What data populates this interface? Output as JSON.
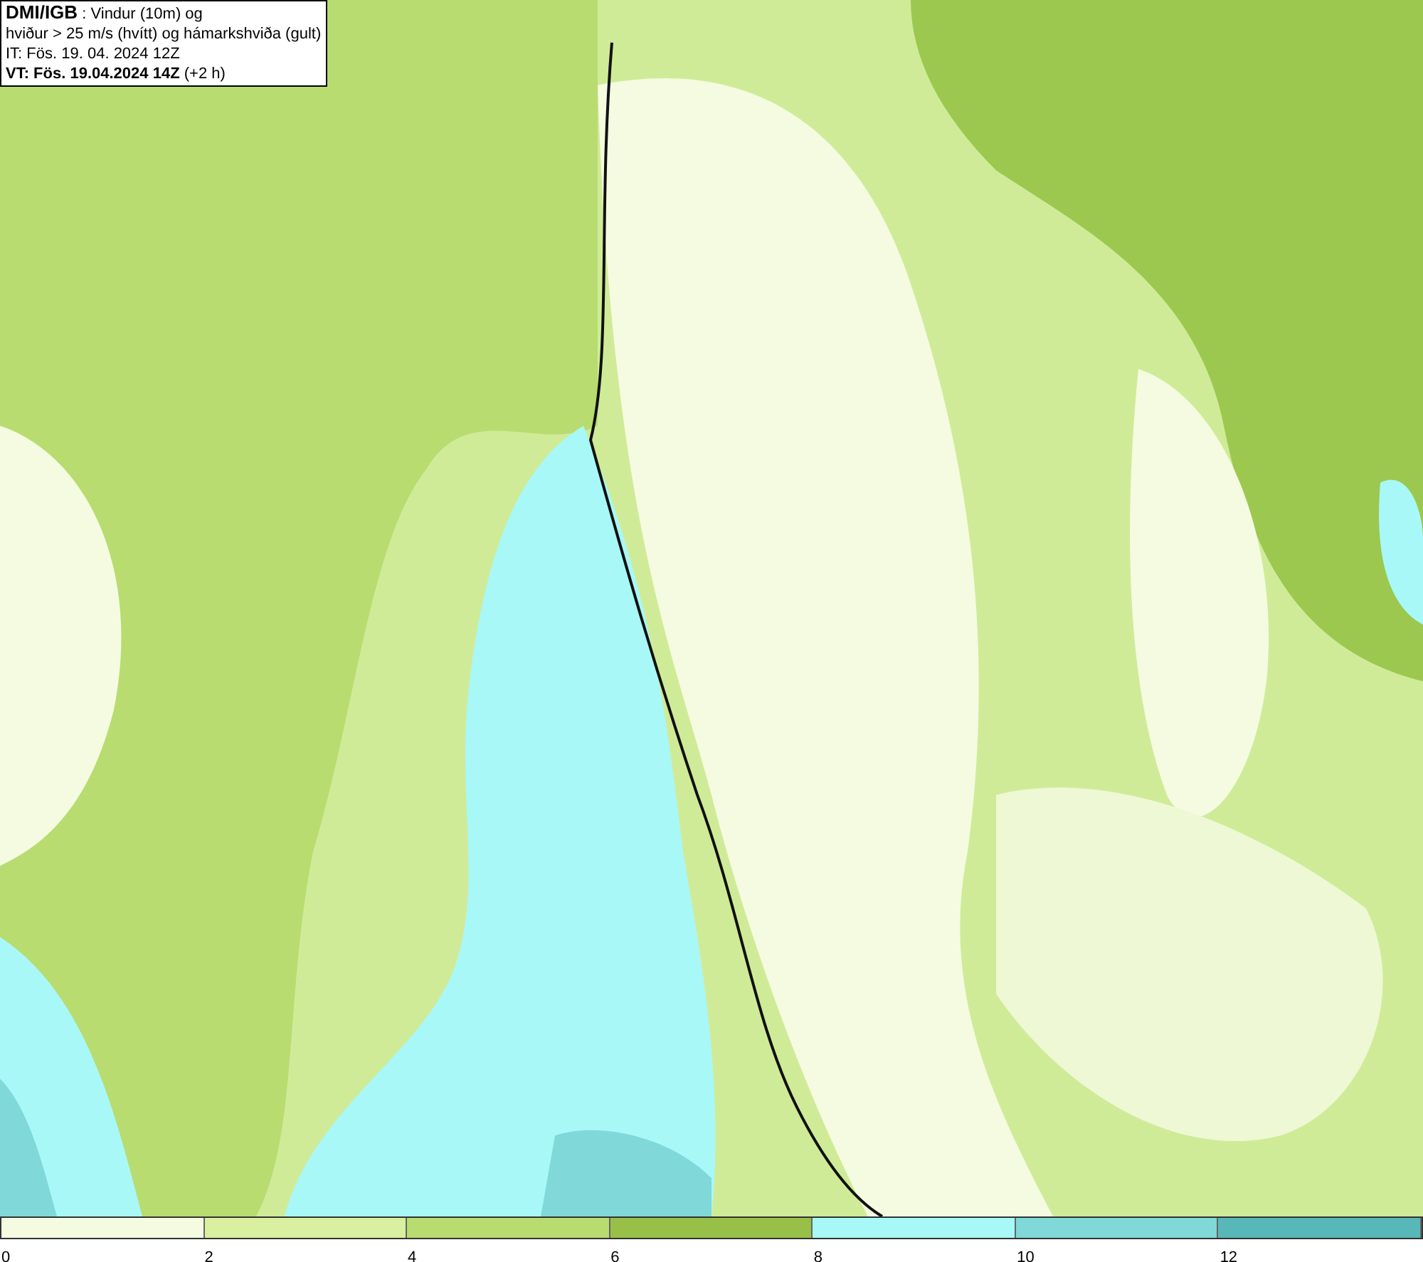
{
  "info_box": {
    "lines": [
      "**DMI/IGB** : Vindur (10m) og",
      "hviður > 25 m/s (hvítt) og hámarkshviða (gult)",
      "IT: Fös. 19. 04. 2024 12Z",
      "**VT: Fös. 19.04.2024 14Z** (+2 h)"
    ]
  },
  "colorbar": {
    "segments": [
      {
        "label": "0",
        "color": "#f4fbe0"
      },
      {
        "label": "2",
        "color": "#d8f0a0"
      },
      {
        "label": "4",
        "color": "#b8dc70"
      },
      {
        "label": "6",
        "color": "#98c048"
      },
      {
        "label": "8",
        "color": "#a8f8f8"
      },
      {
        "label": "10",
        "color": "#80d8d8"
      },
      {
        "label": "12",
        "color": "#58b8b8"
      }
    ]
  }
}
